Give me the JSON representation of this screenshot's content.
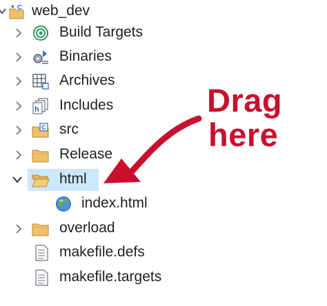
{
  "tree": {
    "project": "web_dev",
    "items": [
      {
        "label": "Build Targets",
        "icon": "build-targets-icon"
      },
      {
        "label": "Binaries",
        "icon": "binaries-icon"
      },
      {
        "label": "Archives",
        "icon": "archives-icon"
      },
      {
        "label": "Includes",
        "icon": "includes-icon"
      },
      {
        "label": "src",
        "icon": "source-folder-icon"
      },
      {
        "label": "Release",
        "icon": "folder-icon"
      },
      {
        "label": "html",
        "icon": "folder-open-icon",
        "selected": true,
        "expanded": true
      },
      {
        "label": "index.html",
        "icon": "globe-icon"
      },
      {
        "label": "overload",
        "icon": "folder-icon"
      },
      {
        "label": "makefile.defs",
        "icon": "file-icon"
      },
      {
        "label": "makefile.targets",
        "icon": "file-icon"
      }
    ]
  },
  "annotation": {
    "line1": "Drag",
    "line2": "here",
    "color": "#c8102e"
  },
  "colors": {
    "selection": "#cce8ff",
    "folder": "#f1c06a"
  }
}
